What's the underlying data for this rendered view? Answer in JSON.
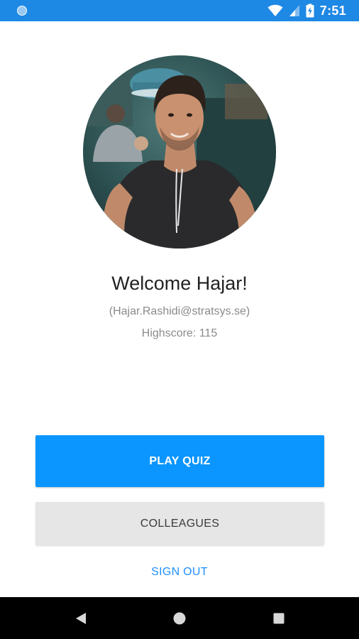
{
  "status_bar": {
    "time": "7:51",
    "icons": [
      "notification-dot-icon",
      "wifi-icon",
      "cell-signal-icon",
      "battery-charging-icon"
    ],
    "background": "#1E88E5"
  },
  "profile": {
    "avatar_icon": "user-photo",
    "welcome": "Welcome Hajar!",
    "email": "(Hajar.Rashidi@stratsys.se)",
    "highscore": "Highscore: 115"
  },
  "actions": {
    "play_quiz": "PLAY QUIZ",
    "colleagues": "COLLEAGUES",
    "sign_out": "SIGN OUT"
  },
  "colors": {
    "primary": "#0A95FF",
    "secondary_button": "#E6E6E6",
    "link": "#1E90FF"
  },
  "nav_bar": {
    "icons": [
      "back-icon",
      "home-icon",
      "recents-icon"
    ]
  }
}
